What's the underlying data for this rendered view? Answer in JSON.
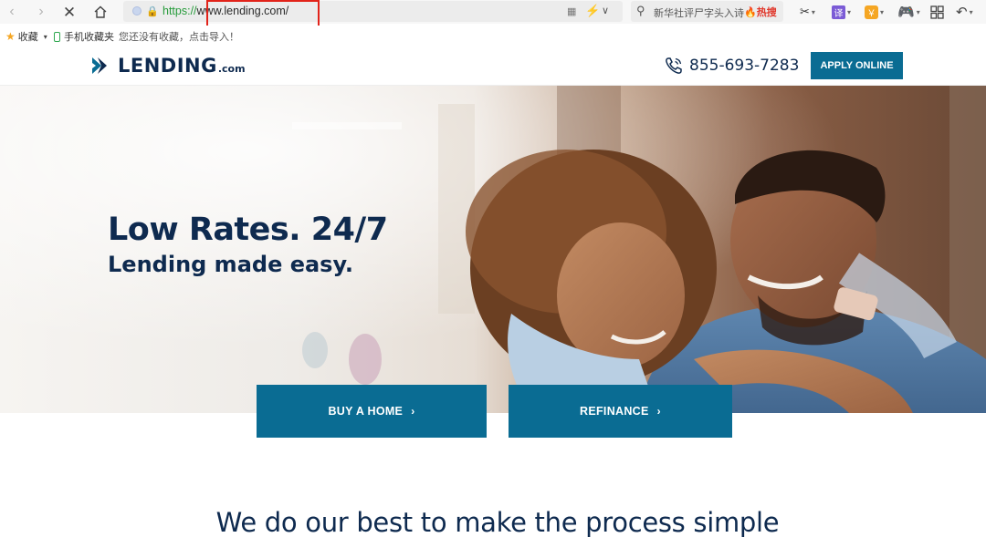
{
  "browser": {
    "url_protocol": "https://",
    "url_host": "www.lending.com/",
    "search_query": "新华社评尸字头入诗",
    "search_hot": "🔥热搜",
    "translate_glyph": "译",
    "shield_glyph": "￥",
    "icons": [
      "back-icon",
      "forward-icon",
      "stop-icon",
      "home-icon",
      "lock-icon",
      "search-icon",
      "scissors-icon",
      "translate-icon",
      "shield-icon",
      "game-icon",
      "apps-icon",
      "undo-icon"
    ]
  },
  "bookmarks": {
    "favorites_label": "收藏",
    "mobile_label": "手机收藏夹",
    "hint": "您还没有收藏，点击导入！"
  },
  "header": {
    "logo_text": "LENDING",
    "logo_tld": ".com",
    "phone": "855-693-7283",
    "apply_label": "APPLY ONLINE"
  },
  "hero": {
    "title": "Low Rates. 24/7",
    "subtitle": "Lending made easy."
  },
  "cta": {
    "buy_label": "BUY A HOME",
    "refinance_label": "REFINANCE",
    "arrow": "›"
  },
  "tagline": "We do our best to make the process simple",
  "colors": {
    "brand_navy": "#0e2a4f",
    "brand_teal": "#0a6c93",
    "highlight_red": "#e2231a"
  }
}
